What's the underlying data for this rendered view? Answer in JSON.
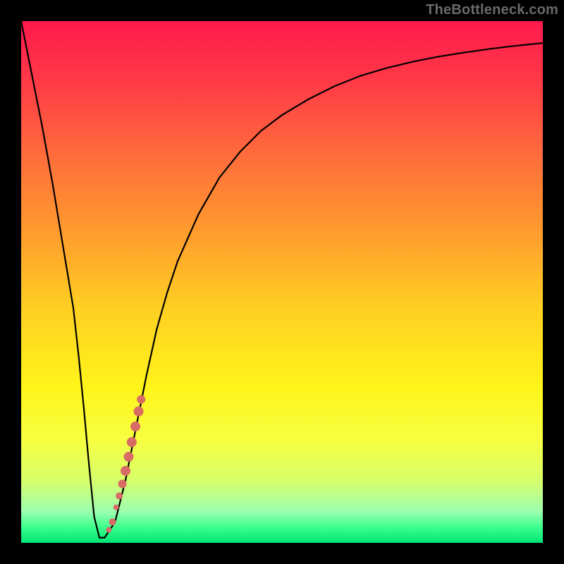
{
  "watermark": "TheBottleneck.com",
  "colors": {
    "frame": "#000000",
    "dot": "#d86b63",
    "curve": "#000000",
    "gradient_top": "#ff1a4d",
    "gradient_bottom": "#00e574"
  },
  "chart_data": {
    "type": "line",
    "title": "",
    "xlabel": "",
    "ylabel": "",
    "xlim": [
      0,
      100
    ],
    "ylim": [
      0,
      100
    ],
    "grid": false,
    "series": [
      {
        "name": "bottleneck-curve",
        "x": [
          0,
          2,
          4,
          6,
          8,
          10,
          11,
          12,
          13,
          14,
          15,
          16,
          18,
          20,
          22,
          24,
          26,
          28,
          30,
          34,
          38,
          42,
          46,
          50,
          55,
          60,
          65,
          70,
          75,
          80,
          85,
          90,
          95,
          100
        ],
        "y": [
          100,
          90,
          80,
          69,
          57,
          45,
          36,
          26,
          15,
          5,
          1,
          1,
          4,
          12,
          22,
          32,
          41,
          48,
          54,
          63,
          70,
          75,
          79,
          82,
          85,
          87.5,
          89.5,
          91,
          92.2,
          93.2,
          94,
          94.7,
          95.3,
          95.8
        ]
      }
    ],
    "dots": {
      "name": "highlight-dots",
      "points": [
        {
          "x": 16.8,
          "y": 2.5,
          "r": 4
        },
        {
          "x": 17.5,
          "y": 4.0,
          "r": 5
        },
        {
          "x": 18.2,
          "y": 6.8,
          "r": 4
        },
        {
          "x": 18.8,
          "y": 9.0,
          "r": 5
        },
        {
          "x": 19.4,
          "y": 11.3,
          "r": 6
        },
        {
          "x": 20.0,
          "y": 13.8,
          "r": 7
        },
        {
          "x": 20.6,
          "y": 16.5,
          "r": 7
        },
        {
          "x": 21.2,
          "y": 19.3,
          "r": 7
        },
        {
          "x": 21.9,
          "y": 22.3,
          "r": 7
        },
        {
          "x": 22.5,
          "y": 25.2,
          "r": 7
        },
        {
          "x": 23.0,
          "y": 27.5,
          "r": 6
        }
      ]
    }
  }
}
